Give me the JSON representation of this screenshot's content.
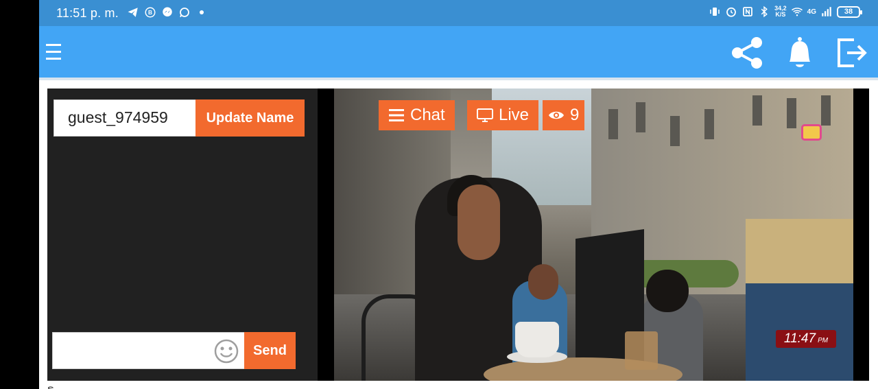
{
  "status_bar": {
    "time": "11:51 p. m.",
    "left_icons": [
      "telegram-icon",
      "b-badge-icon",
      "messenger-icon",
      "whatsapp-icon"
    ],
    "speed": "34,2",
    "speed_unit": "K/S",
    "network": "4G",
    "battery": "38",
    "right_icons": [
      "vibrate-icon",
      "alarm-icon",
      "nfc-icon",
      "bluetooth-icon",
      "wifi-icon",
      "signal-icon"
    ]
  },
  "app_bar": {
    "icons": [
      "menu-icon",
      "share-icon",
      "bell-icon",
      "logout-icon"
    ],
    "color": "#42a5f5"
  },
  "chat": {
    "username": "guest_974959",
    "update_label": "Update Name",
    "message_value": "",
    "send_label": "Send",
    "accent": "#f26a2e"
  },
  "video": {
    "chat_label": "Chat",
    "live_label": "Live",
    "viewers": "9",
    "clock_time": "11:47",
    "clock_suffix": "PM"
  },
  "footer": {
    "partial_text": "ຣ"
  }
}
